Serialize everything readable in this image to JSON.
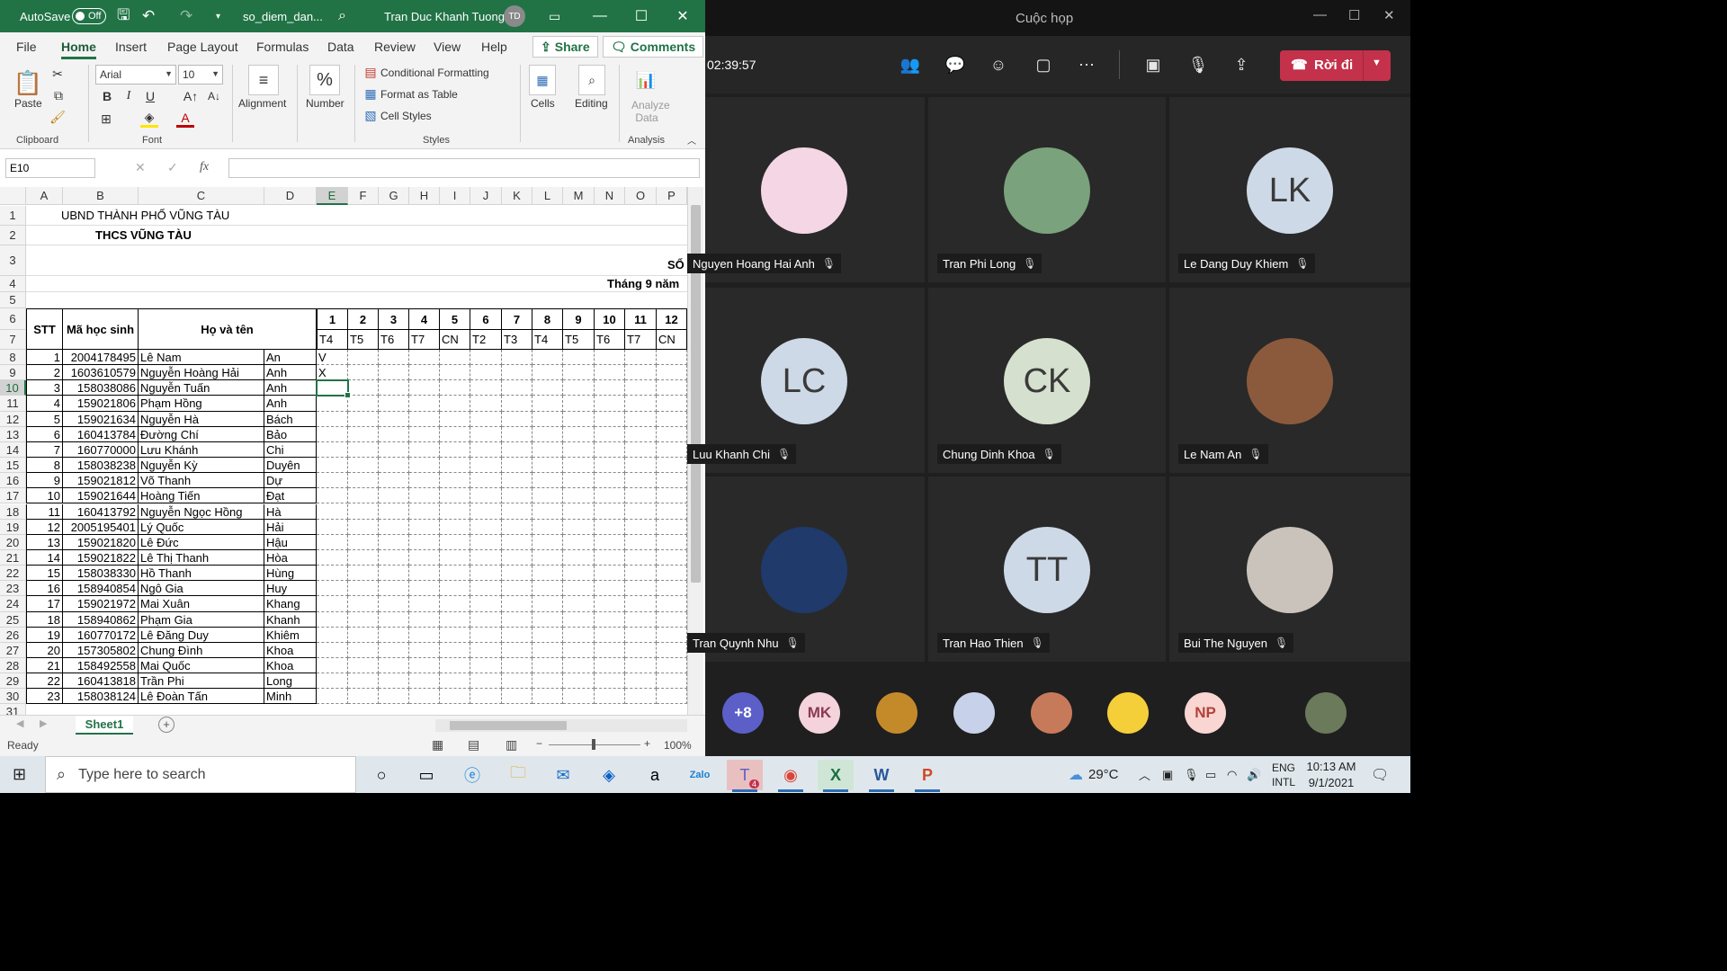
{
  "excel": {
    "autosave_label": "AutoSave",
    "autosave_state": "Off",
    "filename": "so_diem_dan...",
    "user_name": "Tran Duc Khanh Tuong",
    "user_initials": "TD",
    "menu_tabs": [
      "File",
      "Home",
      "Insert",
      "Page Layout",
      "Formulas",
      "Data",
      "Review",
      "View",
      "Help"
    ],
    "active_tab": "Home",
    "share_label": "Share",
    "comments_label": "Comments",
    "ribbon": {
      "paste": "Paste",
      "clipboard": "Clipboard",
      "font_name": "Arial",
      "font_size": "10",
      "font_group": "Font",
      "alignment": "Alignment",
      "number": "Number",
      "conditional_formatting": "Conditional Formatting",
      "format_as_table": "Format as Table",
      "cell_styles": "Cell Styles",
      "styles_group": "Styles",
      "cells": "Cells",
      "editing": "Editing",
      "analyze_data_line1": "Analyze",
      "analyze_data_line2": "Data",
      "analysis_group": "Analysis",
      "bold": "B",
      "italic": "I",
      "underline": "U",
      "number_symbol": "%"
    },
    "name_box": "E10",
    "fx_label": "fx",
    "columns": [
      "A",
      "B",
      "C",
      "D",
      "E",
      "F",
      "G",
      "H",
      "I",
      "J",
      "K",
      "L",
      "M",
      "N",
      "O",
      "P"
    ],
    "selected_column": "E",
    "selected_row": "10",
    "sheet": {
      "title1": "UBND THÀNH PHỐ VŨNG TÀU",
      "title2": "THCS VŨNG TÀU",
      "title3": "SỔ",
      "month": "Tháng 9 năm",
      "hdr_stt": "STT",
      "hdr_code": "Mã học sinh",
      "hdr_name": "Họ và tên",
      "day_numbers": [
        "1",
        "2",
        "3",
        "4",
        "5",
        "6",
        "7",
        "8",
        "9",
        "10",
        "11",
        "12"
      ],
      "weekdays": [
        "T4",
        "T5",
        "T6",
        "T7",
        "CN",
        "T2",
        "T3",
        "T4",
        "T5",
        "T6",
        "T7",
        "CN"
      ],
      "row_numbers": [
        "1",
        "2",
        "3",
        "4",
        "5",
        "6",
        "7",
        "8",
        "9",
        "10",
        "11",
        "12",
        "13",
        "14",
        "15",
        "16",
        "17",
        "18",
        "19",
        "20",
        "21",
        "22",
        "23",
        "24",
        "25",
        "26",
        "27",
        "28",
        "29",
        "30",
        "31"
      ],
      "students": [
        {
          "stt": "1",
          "code": "2004178495",
          "last": "Lê Nam",
          "first": "An",
          "d1": "V"
        },
        {
          "stt": "2",
          "code": "1603610579",
          "last": "Nguyễn Hoàng Hải",
          "first": "Anh",
          "d1": "X"
        },
        {
          "stt": "3",
          "code": "158038086",
          "last": "Nguyễn Tuấn",
          "first": "Anh",
          "d1": ""
        },
        {
          "stt": "4",
          "code": "159021806",
          "last": "Phạm Hồng",
          "first": "Anh",
          "d1": ""
        },
        {
          "stt": "5",
          "code": "159021634",
          "last": "Nguyễn Hà",
          "first": "Bách",
          "d1": ""
        },
        {
          "stt": "6",
          "code": "160413784",
          "last": "Đường Chí",
          "first": "Bảo",
          "d1": ""
        },
        {
          "stt": "7",
          "code": "160770000",
          "last": "Lưu Khánh",
          "first": "Chi",
          "d1": ""
        },
        {
          "stt": "8",
          "code": "158038238",
          "last": "Nguyễn Kỳ",
          "first": "Duyên",
          "d1": ""
        },
        {
          "stt": "9",
          "code": "159021812",
          "last": "Võ Thanh",
          "first": "Dự",
          "d1": ""
        },
        {
          "stt": "10",
          "code": "159021644",
          "last": "Hoàng Tiến",
          "first": "Đạt",
          "d1": ""
        },
        {
          "stt": "11",
          "code": "160413792",
          "last": "Nguyễn Ngọc Hồng",
          "first": "Hà",
          "d1": ""
        },
        {
          "stt": "12",
          "code": "2005195401",
          "last": "Lý Quốc",
          "first": "Hải",
          "d1": ""
        },
        {
          "stt": "13",
          "code": "159021820",
          "last": "Lê Đức",
          "first": "Hậu",
          "d1": ""
        },
        {
          "stt": "14",
          "code": "159021822",
          "last": "Lê Thị Thanh",
          "first": "Hòa",
          "d1": ""
        },
        {
          "stt": "15",
          "code": "158038330",
          "last": "Hồ Thanh",
          "first": "Hùng",
          "d1": ""
        },
        {
          "stt": "16",
          "code": "158940854",
          "last": "Ngô Gia",
          "first": "Huy",
          "d1": ""
        },
        {
          "stt": "17",
          "code": "159021972",
          "last": "Mai Xuân",
          "first": "Khang",
          "d1": ""
        },
        {
          "stt": "18",
          "code": "158940862",
          "last": "Phạm Gia",
          "first": "Khanh",
          "d1": ""
        },
        {
          "stt": "19",
          "code": "160770172",
          "last": "Lê Đăng Duy",
          "first": "Khiêm",
          "d1": ""
        },
        {
          "stt": "20",
          "code": "157305802",
          "last": "Chung Đình",
          "first": "Khoa",
          "d1": ""
        },
        {
          "stt": "21",
          "code": "158492558",
          "last": "Mai Quốc",
          "first": "Khoa",
          "d1": ""
        },
        {
          "stt": "22",
          "code": "160413818",
          "last": "Trần Phi",
          "first": "Long",
          "d1": ""
        },
        {
          "stt": "23",
          "code": "158038124",
          "last": "Lê Đoàn Tấn",
          "first": "Minh",
          "d1": ""
        }
      ]
    },
    "sheet_tab": "Sheet1",
    "status": "Ready",
    "zoom": "100%"
  },
  "teams": {
    "window_title": "Cuộc họp",
    "timer": "02:39:57",
    "leave_label": "Rời đi",
    "tiles": [
      {
        "name": "Nguyen Hoang Hai Anh",
        "initials": "",
        "bg": "#f4d6e4"
      },
      {
        "name": "Tran Phi Long",
        "initials": "",
        "bg": "#7aa27c"
      },
      {
        "name": "Le Dang Duy Khiem",
        "initials": "LK",
        "bg": "#cdd9e6"
      },
      {
        "name": "Luu Khanh Chi",
        "initials": "LC",
        "bg": "#cdd9e6"
      },
      {
        "name": "Chung Dinh Khoa",
        "initials": "CK",
        "bg": "#d5e0cf"
      },
      {
        "name": "Le Nam An",
        "initials": "",
        "bg": "#8b5a3c"
      },
      {
        "name": "Tran Quynh Nhu",
        "initials": "",
        "bg": "#1f3a6b"
      },
      {
        "name": "Tran Hao Thien",
        "initials": "TT",
        "bg": "#cdd9e6"
      },
      {
        "name": "Bui The Nguyen",
        "initials": "",
        "bg": "#c9c3bb"
      }
    ],
    "strip": [
      {
        "label": "+8",
        "bg": "#5b5fc7",
        "fg": "#ffffff"
      },
      {
        "label": "MK",
        "bg": "#f4d3dc",
        "fg": "#8a3a52"
      },
      {
        "label": "",
        "bg": "#c48a2a",
        "fg": "#ffffff"
      },
      {
        "label": "",
        "bg": "#c7d2ea",
        "fg": "#ffffff"
      },
      {
        "label": "",
        "bg": "#c77a5a",
        "fg": "#ffffff"
      },
      {
        "label": "",
        "bg": "#f4cf3a",
        "fg": "#ffffff"
      },
      {
        "label": "NP",
        "bg": "#f9d6d2",
        "fg": "#b5403a"
      },
      {
        "label": "",
        "bg": "#6a7a5a",
        "fg": "#ffffff"
      }
    ]
  },
  "taskbar": {
    "search_placeholder": "Type here to search",
    "temperature": "29°C",
    "lang1": "ENG",
    "lang2": "INTL",
    "time": "10:13 AM",
    "date": "9/1/2021",
    "teams_badge": "4"
  }
}
